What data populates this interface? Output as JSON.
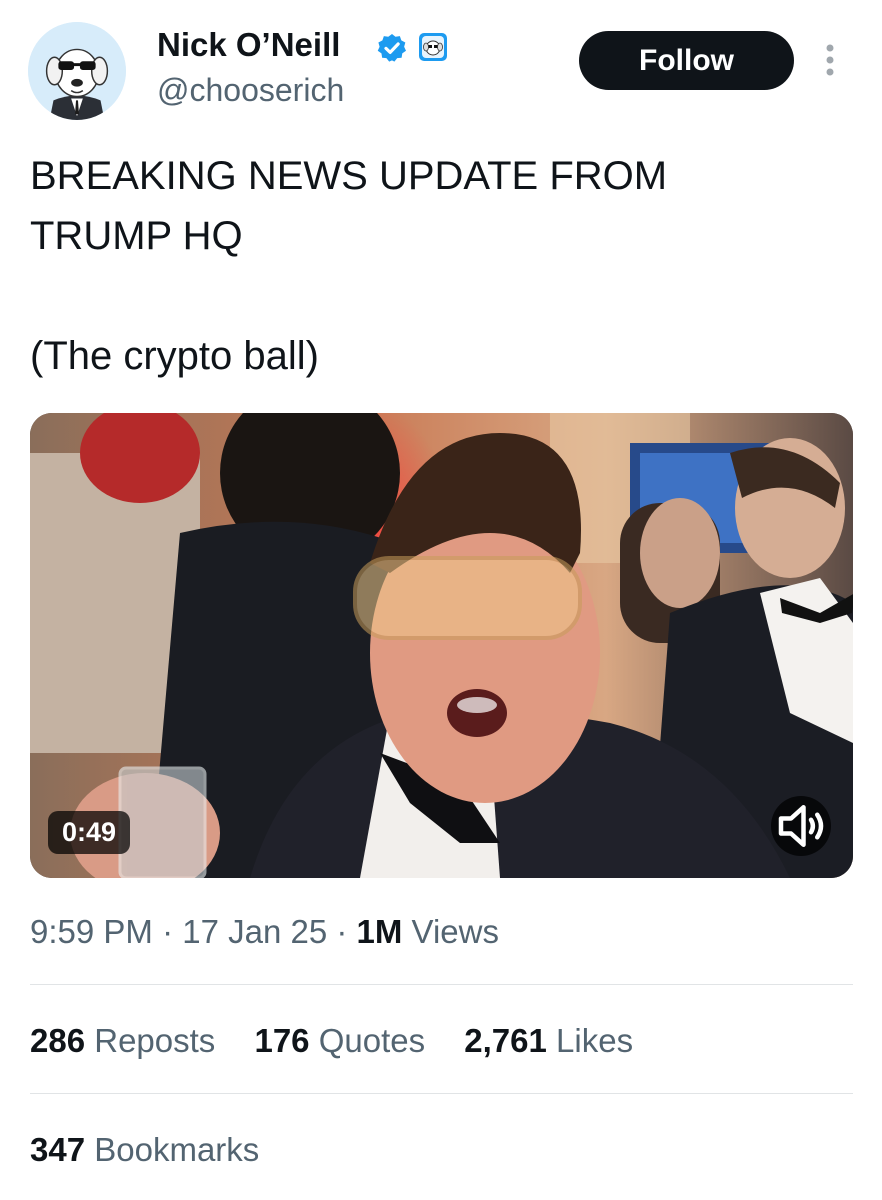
{
  "author": {
    "name": "Nick O’Neill",
    "handle": "@chooserich",
    "avatar_icon": "dog-in-sunglasses-avatar",
    "verified_icon": "verified-badge-icon",
    "affiliation_icon": "affiliate-badge-icon"
  },
  "follow_label": "Follow",
  "more_icon": "more-options-icon",
  "tweet": {
    "line1": "BREAKING NEWS UPDATE FROM",
    "line2": "TRUMP HQ",
    "line3": "(The crypto ball)"
  },
  "video": {
    "duration": "0:49",
    "mute_icon": "speaker-icon",
    "scene": "man in tinted glasses and tuxedo at a party"
  },
  "meta": {
    "time": "9:59 PM",
    "sep1": " · ",
    "date": "17 Jan 25",
    "sep2": " · ",
    "views_count": "1M",
    "views_label": " Views"
  },
  "stats": {
    "reposts_count": "286",
    "reposts_label": "Reposts",
    "quotes_count": "176",
    "quotes_label": "Quotes",
    "likes_count": "2,761",
    "likes_label": "Likes",
    "bookmarks_count": "347",
    "bookmarks_label": "Bookmarks"
  },
  "colors": {
    "text": "#0f1419",
    "secondary": "#536471",
    "verified_blue": "#1d9bf0",
    "follow_bg": "#0f1419"
  }
}
